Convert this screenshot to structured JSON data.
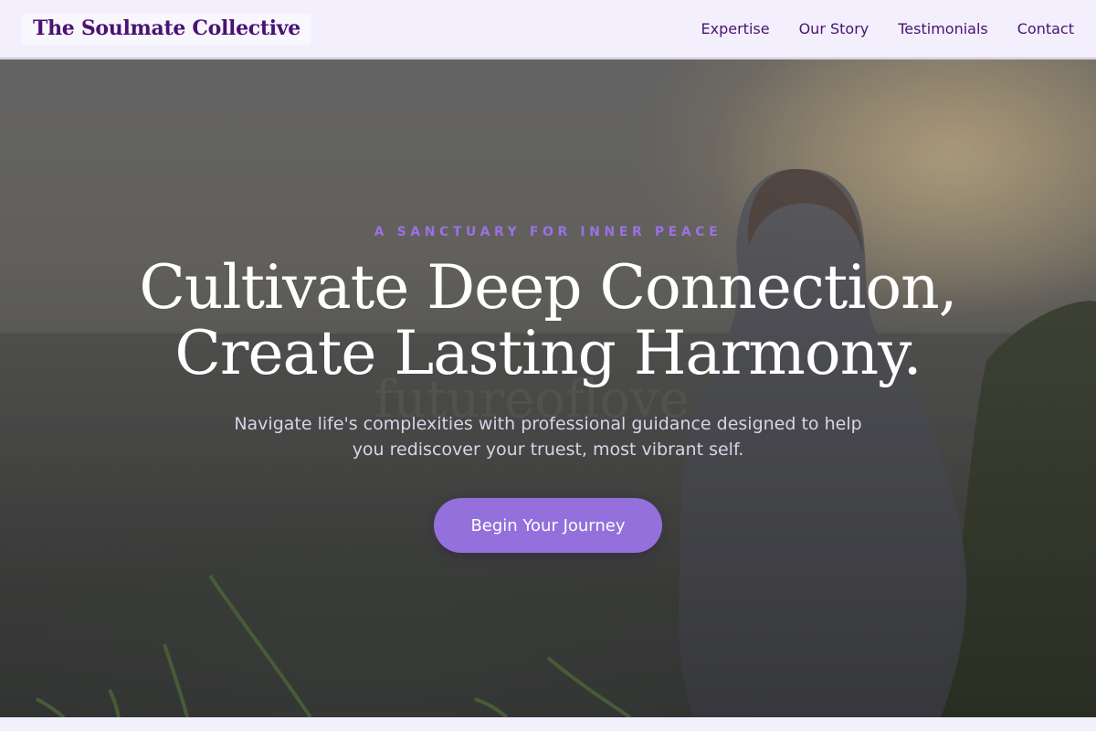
{
  "brand": {
    "name": "The Soulmate Collective"
  },
  "nav": {
    "links": [
      {
        "label": "Expertise"
      },
      {
        "label": "Our Story"
      },
      {
        "label": "Testimonials"
      },
      {
        "label": "Contact"
      }
    ]
  },
  "hero": {
    "eyebrow": "A SANCTUARY FOR INNER PEACE",
    "headline_line1": "Cultivate Deep Connection,",
    "headline_line2": "Create Lasting Harmony.",
    "subtext": "Navigate life's complexities with professional guidance designed to help you rediscover your truest, most vibrant self.",
    "cta_label": "Begin Your Journey",
    "background_image": "woman-sitting-on-cliff-by-sea-at-sunset",
    "watermark": "futureoflove"
  },
  "colors": {
    "brand_purple": "#4a1273",
    "accent_lavender": "#9370db",
    "eyebrow_purple": "#9a72e3",
    "nav_background": "#f3effc"
  }
}
